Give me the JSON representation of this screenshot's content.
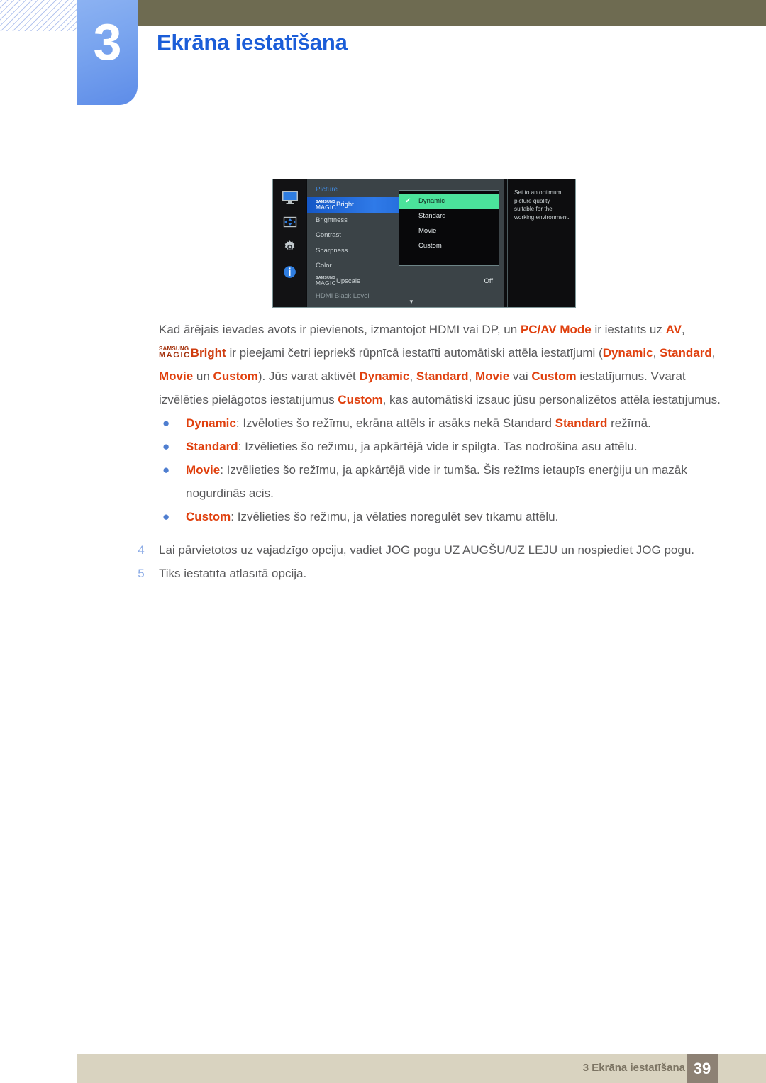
{
  "header": {
    "chapter_number": "3",
    "chapter_title": "Ekrāna iestatīšana"
  },
  "osd": {
    "icons": [
      {
        "name": "monitor-icon",
        "label": "Picture"
      },
      {
        "name": "screen-adjust-icon",
        "label": "OnScreen Display"
      },
      {
        "name": "gear-icon",
        "label": "System"
      },
      {
        "name": "info-icon",
        "label": "Information"
      }
    ],
    "menu_title": "Picture",
    "items": [
      {
        "magic_top": "SAMSUNG",
        "magic_bottom": "MAGIC",
        "label": "Bright",
        "value": "",
        "selected": true,
        "dim": false
      },
      {
        "magic_top": "",
        "magic_bottom": "",
        "label": "Brightness",
        "value": "",
        "selected": false,
        "dim": false
      },
      {
        "magic_top": "",
        "magic_bottom": "",
        "label": "Contrast",
        "value": "",
        "selected": false,
        "dim": false
      },
      {
        "magic_top": "",
        "magic_bottom": "",
        "label": "Sharpness",
        "value": "",
        "selected": false,
        "dim": false
      },
      {
        "magic_top": "",
        "magic_bottom": "",
        "label": "Color",
        "value": "",
        "selected": false,
        "dim": false
      },
      {
        "magic_top": "SAMSUNG",
        "magic_bottom": "MAGIC",
        "label": "Upscale",
        "value": "Off",
        "selected": false,
        "dim": false
      },
      {
        "magic_top": "",
        "magic_bottom": "",
        "label": "HDMI Black Level",
        "value": "",
        "selected": false,
        "dim": true
      }
    ],
    "scroll_arrow": "▼",
    "dropdown": {
      "check_glyph": "✔",
      "options": [
        {
          "label": "Dynamic",
          "active": true
        },
        {
          "label": "Standard",
          "active": false
        },
        {
          "label": "Movie",
          "active": false
        },
        {
          "label": "Custom",
          "active": false
        }
      ]
    },
    "help_text": "Set to an optimum picture quality suitable for the working environment."
  },
  "body": {
    "paragraph1": {
      "t1": "Kad ārējais ievades avots ir pievienots, izmantojot HDMI vai DP, un ",
      "h1": "PC/AV Mode",
      "t2": " ir iestatīts uz ",
      "h2": "AV",
      "t3": ","
    },
    "paragraph2": {
      "magic_top": "SAMSUNG",
      "magic_bottom": "MAGIC",
      "h0": "Bright",
      "t1": " ir pieejami četri iepriekš rūpnīcā iestatīti automātiski attēla iestatījumi (",
      "h1": "Dynamic",
      "t2": ", ",
      "h2": "Standard",
      "t3": ", ",
      "h3": "Movie",
      "t4": " un ",
      "h4": "Custom",
      "t5": "). Jūs varat aktivēt ",
      "h5": "Dynamic",
      "t6": ", ",
      "h6": "Standard",
      "t7": ", ",
      "h7": "Movie",
      "t8": " vai ",
      "h8": "Custom",
      "t9": " iestatījumus. Vvarat izvēlēties pielāgotos iestatījumus ",
      "h9": "Custom",
      "t10": ", kas automātiski izsauc jūsu personalizētos attēla iestatījumus."
    },
    "bullet_marker": "●",
    "bullets": [
      {
        "lead": "Dynamic",
        "t1": ": Izvēloties šo režīmu, ekrāna attēls ir asāks nekā Standard ",
        "hl": "Standard",
        "t2": " režīmā."
      },
      {
        "lead": "Standard",
        "t1": ": Izvēlieties šo režīmu, ja apkārtējā vide ir spilgta. Tas nodrošina asu attēlu.",
        "hl": "",
        "t2": ""
      },
      {
        "lead": "Movie",
        "t1": ": Izvēlieties šo režīmu, ja apkārtējā vide ir tumša. Šis režīms ietaupīs enerģiju un mazāk nogurdinās acis.",
        "hl": "",
        "t2": ""
      },
      {
        "lead": "Custom",
        "t1": ": Izvēlieties šo režīmu, ja vēlaties noregulēt sev tīkamu attēlu.",
        "hl": "",
        "t2": ""
      }
    ],
    "steps": [
      {
        "num": "4",
        "text": "Lai pārvietotos uz vajadzīgo opciju, vadiet JOG pogu UZ AUGŠU/UZ LEJU un nospiediet JOG pogu."
      },
      {
        "num": "5",
        "text": "Tiks iestatīta atlasītā opcija."
      }
    ]
  },
  "footer": {
    "text": "3 Ekrāna iestatīšana",
    "page": "39"
  },
  "colors": {
    "olive": "#6e6b51",
    "chapter_blue": "#1b5dd8",
    "accent_red": "#e0400e",
    "footer_bar": "#d9d3c0",
    "footer_page_box": "#8d8174",
    "osd_highlight_green": "#4be39b"
  }
}
